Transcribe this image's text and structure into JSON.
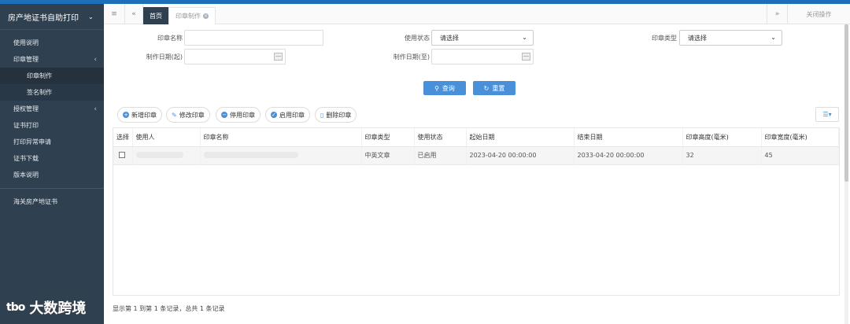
{
  "sidebar": {
    "title": "房产地证书自助打印",
    "items": [
      {
        "label": "使用说明"
      },
      {
        "label": "印章管理"
      },
      {
        "label": "印章制作"
      },
      {
        "label": "签名制作"
      },
      {
        "label": "授权管理"
      },
      {
        "label": "证书打印"
      },
      {
        "label": "打印异常申请"
      },
      {
        "label": "证书下载"
      },
      {
        "label": "版本说明"
      },
      {
        "label": "海关房产地证书"
      }
    ]
  },
  "tabs": {
    "home": "首页",
    "current": "印章制作",
    "close_ops": "关闭操作"
  },
  "form": {
    "seal_name_label": "印章名称",
    "status_label": "使用状态",
    "status_value": "请选择",
    "type_label": "印章类型",
    "type_value": "请选择",
    "date_start_label": "制作日期(起)",
    "date_end_label": "制作日期(至)",
    "search_btn": "查询",
    "reset_btn": "重置"
  },
  "toolbar": {
    "add": "新增印章",
    "edit": "修改印章",
    "disable": "停用印章",
    "enable": "启用印章",
    "delete": "删除印章"
  },
  "table": {
    "headers": [
      "选择",
      "使用人",
      "印章名称",
      "印章类型",
      "使用状态",
      "起始日期",
      "结束日期",
      "印章高度(毫米)",
      "印章宽度(毫米)"
    ],
    "rows": [
      {
        "user": "",
        "name": "",
        "type": "中英文章",
        "status": "已启用",
        "start": "2023-04-20 00:00:00",
        "end": "2033-04-20 00:00:00",
        "height": "32",
        "width": "45"
      }
    ]
  },
  "pager": "显示第 1 到第 1 条记录，总共 1 条记录",
  "watermark": {
    "logo": "tbo",
    "text": "大数跨境"
  }
}
